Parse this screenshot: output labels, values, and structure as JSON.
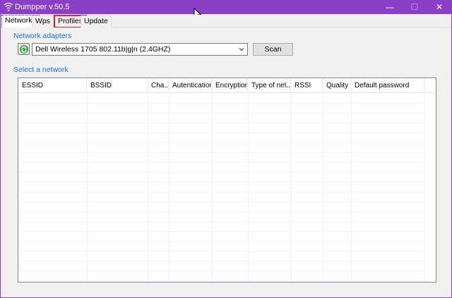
{
  "window": {
    "title": "Dumpper v.50.5",
    "minimize_glyph": "—",
    "maximize_glyph": "☐",
    "close_glyph": "✕",
    "accent_color": "#8a3fc7"
  },
  "tabs": [
    {
      "label": "Networks"
    },
    {
      "label": "Wps"
    },
    {
      "label": "Profiles"
    },
    {
      "label": "Update"
    }
  ],
  "adapters": {
    "label": "Network adapters",
    "selected": "Dell Wireless 1705 802.11b|g|n (2.4GHZ)",
    "scan_label": "Scan",
    "refresh_icon": "refresh-icon"
  },
  "networks": {
    "label": "Select a network",
    "columns": [
      {
        "label": "ESSID"
      },
      {
        "label": "BSSID"
      },
      {
        "label": "Cha..."
      },
      {
        "label": "Autentication"
      },
      {
        "label": "Encryption"
      },
      {
        "label": "Type of net..."
      },
      {
        "label": "RSSI"
      },
      {
        "label": "Quality"
      },
      {
        "label": "Default password"
      }
    ]
  }
}
